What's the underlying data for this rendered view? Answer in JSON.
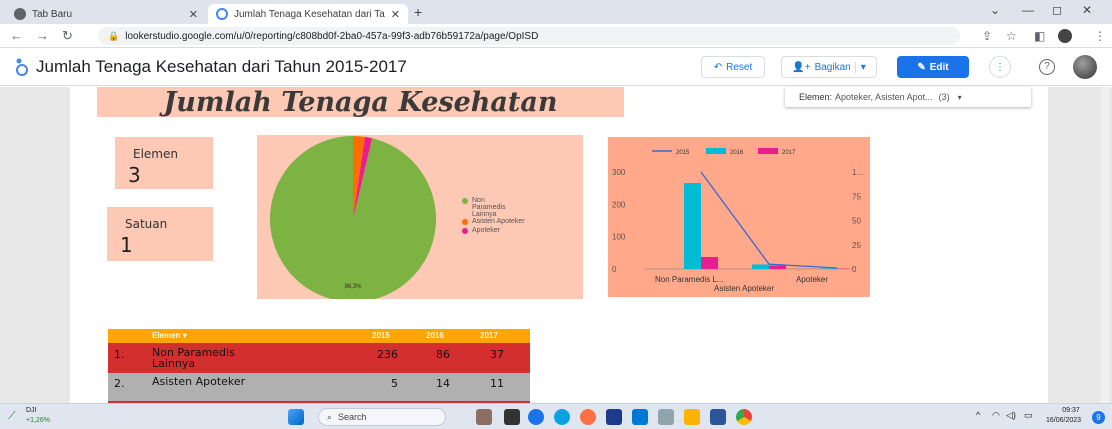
{
  "browser": {
    "tabs": [
      {
        "label": "Tab Baru"
      },
      {
        "label": "Jumlah Tenaga Kesehatan dari Ta"
      }
    ],
    "url": "lookerstudio.google.com/u/0/reporting/c808bd0f-2ba0-457a-99f3-adb76b59172a/page/OpISD"
  },
  "report": {
    "title": "Jumlah Tenaga Kesehatan dari Tahun 2015-2017",
    "reset_label": "Reset",
    "share_label": "Bagikan",
    "edit_label": "Edit"
  },
  "canvas": {
    "heading": "Jumlah Tenaga Kesehatan",
    "filter_label": "Elemen:",
    "filter_value": "Apoteker, Asisten Apot...",
    "filter_count": "(3)"
  },
  "scorecards": [
    {
      "label": "Elemen",
      "value": "3"
    },
    {
      "label": "Satuan",
      "value": "1"
    }
  ],
  "pie": {
    "pct_label": "96,3%",
    "legend": [
      {
        "label": "Non Paramedis Lainnya",
        "color": "#7cb342"
      },
      {
        "label": "Asisten Apoteker",
        "color": "#ff6d00"
      },
      {
        "label": "Apoteker",
        "color": "#e91e8c"
      }
    ]
  },
  "bar_legend": [
    "2015",
    "2016",
    "2017"
  ],
  "bar_axis": {
    "left_ticks": [
      "300",
      "200",
      "100",
      "0"
    ],
    "right_ticks": [
      "1...",
      "75",
      "50",
      "25",
      "0"
    ],
    "x_labels": [
      "Non Paramedis L...",
      "Apoteker"
    ],
    "x_label2": "Asisten Apoteker"
  },
  "chart_data": [
    {
      "type": "pie",
      "categories": [
        "Non Paramedis Lainnya",
        "Asisten Apoteker",
        "Apoteker"
      ],
      "values": [
        96.3,
        2.3,
        1.4
      ],
      "colors": [
        "#7cb342",
        "#ff6d00",
        "#e91e8c"
      ],
      "labels": [
        "96,3%"
      ]
    },
    {
      "type": "bar",
      "categories": [
        "Non Paramedis Lainnya",
        "Asisten Apoteker",
        "Apoteker"
      ],
      "series": [
        {
          "name": "2015",
          "type": "line",
          "axis": "right",
          "values": [
            236,
            5,
            1
          ]
        },
        {
          "name": "2016",
          "type": "bar",
          "color": "#00bcd4",
          "values": [
            266,
            14,
            2
          ]
        },
        {
          "name": "2017",
          "type": "bar",
          "color": "#e91e8c",
          "values": [
            37,
            11,
            1
          ]
        }
      ],
      "ylim": [
        0,
        300
      ],
      "y2lim": [
        0,
        100
      ]
    }
  ],
  "table": {
    "headers": [
      "Elemen",
      "2015",
      "2016",
      "2017"
    ],
    "rows": [
      {
        "idx": "1.",
        "name": "Non Paramedis Lainnya",
        "v2015": "236",
        "v2016": "86",
        "v2017": "37"
      },
      {
        "idx": "2.",
        "name": "Asisten Apoteker",
        "v2015": "5",
        "v2016": "14",
        "v2017": "11"
      }
    ]
  },
  "taskbar": {
    "weather_temp": "DJI",
    "weather_change": "+1,26%",
    "search_label": "Search",
    "time": "09:37",
    "date": "16/06/2023",
    "notif_count": "9"
  }
}
